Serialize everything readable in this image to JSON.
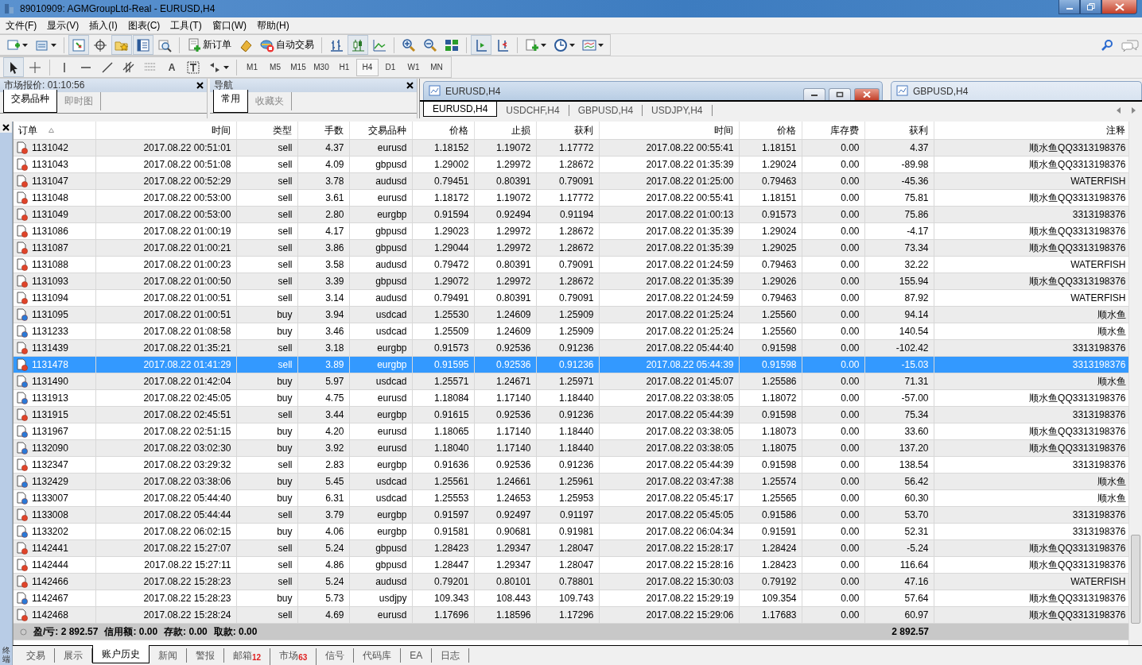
{
  "window": {
    "title": "89010909: AGMGroupLtd-Real - EURUSD,H4"
  },
  "menu": [
    "文件(F)",
    "显示(V)",
    "插入(I)",
    "图表(C)",
    "工具(T)",
    "窗口(W)",
    "帮助(H)"
  ],
  "toolbar": {
    "new_order": "新订单",
    "auto_trading": "自动交易"
  },
  "drawing_tools": {
    "text_tool": "A"
  },
  "timeframes": [
    {
      "label": "M1",
      "selected": false
    },
    {
      "label": "M5",
      "selected": false
    },
    {
      "label": "M15",
      "selected": false
    },
    {
      "label": "M30",
      "selected": false
    },
    {
      "label": "H1",
      "selected": false
    },
    {
      "label": "H4",
      "selected": true
    },
    {
      "label": "D1",
      "selected": false
    },
    {
      "label": "W1",
      "selected": false
    },
    {
      "label": "MN",
      "selected": false
    }
  ],
  "market_watch": {
    "title": "市场报价: 01:10:56",
    "tabs": [
      {
        "label": "交易品种",
        "selected": true
      },
      {
        "label": "即时图",
        "selected": false
      }
    ]
  },
  "navigator": {
    "title": "导航",
    "tabs": [
      {
        "label": "常用",
        "selected": true
      },
      {
        "label": "收藏夹",
        "selected": false
      }
    ]
  },
  "chart_windows": [
    {
      "title": "EURUSD,H4",
      "active": true
    },
    {
      "title": "GBPUSD,H4",
      "active": false
    }
  ],
  "chart_tabs": [
    {
      "label": "EURUSD,H4",
      "selected": true
    },
    {
      "label": "USDCHF,H4",
      "selected": false
    },
    {
      "label": "GBPUSD,H4",
      "selected": false
    },
    {
      "label": "USDJPY,H4",
      "selected": false
    }
  ],
  "terminal": {
    "label": "终端",
    "columns": [
      "订单",
      "时间",
      "类型",
      "手数",
      "交易品种",
      "价格",
      "止损",
      "获利",
      "时间",
      "价格",
      "库存费",
      "获利",
      "注释"
    ],
    "rows": [
      {
        "kind": "sell",
        "selected": false,
        "cells": [
          "1131042",
          "2017.08.22 00:51:01",
          "sell",
          "4.37",
          "eurusd",
          "1.18152",
          "1.19072",
          "1.17772",
          "2017.08.22 00:55:41",
          "1.18151",
          "0.00",
          "4.37",
          "顺水鱼QQ3313198376"
        ]
      },
      {
        "kind": "sell",
        "selected": false,
        "cells": [
          "1131043",
          "2017.08.22 00:51:08",
          "sell",
          "4.09",
          "gbpusd",
          "1.29002",
          "1.29972",
          "1.28672",
          "2017.08.22 01:35:39",
          "1.29024",
          "0.00",
          "-89.98",
          "顺水鱼QQ3313198376"
        ]
      },
      {
        "kind": "sell",
        "selected": false,
        "cells": [
          "1131047",
          "2017.08.22 00:52:29",
          "sell",
          "3.78",
          "audusd",
          "0.79451",
          "0.80391",
          "0.79091",
          "2017.08.22 01:25:00",
          "0.79463",
          "0.00",
          "-45.36",
          "WATERFISH"
        ]
      },
      {
        "kind": "sell",
        "selected": false,
        "cells": [
          "1131048",
          "2017.08.22 00:53:00",
          "sell",
          "3.61",
          "eurusd",
          "1.18172",
          "1.19072",
          "1.17772",
          "2017.08.22 00:55:41",
          "1.18151",
          "0.00",
          "75.81",
          "顺水鱼QQ3313198376"
        ]
      },
      {
        "kind": "sell",
        "selected": false,
        "cells": [
          "1131049",
          "2017.08.22 00:53:00",
          "sell",
          "2.80",
          "eurgbp",
          "0.91594",
          "0.92494",
          "0.91194",
          "2017.08.22 01:00:13",
          "0.91573",
          "0.00",
          "75.86",
          "3313198376"
        ]
      },
      {
        "kind": "sell",
        "selected": false,
        "cells": [
          "1131086",
          "2017.08.22 01:00:19",
          "sell",
          "4.17",
          "gbpusd",
          "1.29023",
          "1.29972",
          "1.28672",
          "2017.08.22 01:35:39",
          "1.29024",
          "0.00",
          "-4.17",
          "顺水鱼QQ3313198376"
        ]
      },
      {
        "kind": "sell",
        "selected": false,
        "cells": [
          "1131087",
          "2017.08.22 01:00:21",
          "sell",
          "3.86",
          "gbpusd",
          "1.29044",
          "1.29972",
          "1.28672",
          "2017.08.22 01:35:39",
          "1.29025",
          "0.00",
          "73.34",
          "顺水鱼QQ3313198376"
        ]
      },
      {
        "kind": "sell",
        "selected": false,
        "cells": [
          "1131088",
          "2017.08.22 01:00:23",
          "sell",
          "3.58",
          "audusd",
          "0.79472",
          "0.80391",
          "0.79091",
          "2017.08.22 01:24:59",
          "0.79463",
          "0.00",
          "32.22",
          "WATERFISH"
        ]
      },
      {
        "kind": "sell",
        "selected": false,
        "cells": [
          "1131093",
          "2017.08.22 01:00:50",
          "sell",
          "3.39",
          "gbpusd",
          "1.29072",
          "1.29972",
          "1.28672",
          "2017.08.22 01:35:39",
          "1.29026",
          "0.00",
          "155.94",
          "顺水鱼QQ3313198376"
        ]
      },
      {
        "kind": "sell",
        "selected": false,
        "cells": [
          "1131094",
          "2017.08.22 01:00:51",
          "sell",
          "3.14",
          "audusd",
          "0.79491",
          "0.80391",
          "0.79091",
          "2017.08.22 01:24:59",
          "0.79463",
          "0.00",
          "87.92",
          "WATERFISH"
        ]
      },
      {
        "kind": "buy",
        "selected": false,
        "cells": [
          "1131095",
          "2017.08.22 01:00:51",
          "buy",
          "3.94",
          "usdcad",
          "1.25530",
          "1.24609",
          "1.25909",
          "2017.08.22 01:25:24",
          "1.25560",
          "0.00",
          "94.14",
          "顺水鱼"
        ]
      },
      {
        "kind": "buy",
        "selected": false,
        "cells": [
          "1131233",
          "2017.08.22 01:08:58",
          "buy",
          "3.46",
          "usdcad",
          "1.25509",
          "1.24609",
          "1.25909",
          "2017.08.22 01:25:24",
          "1.25560",
          "0.00",
          "140.54",
          "顺水鱼"
        ]
      },
      {
        "kind": "sell",
        "selected": false,
        "cells": [
          "1131439",
          "2017.08.22 01:35:21",
          "sell",
          "3.18",
          "eurgbp",
          "0.91573",
          "0.92536",
          "0.91236",
          "2017.08.22 05:44:40",
          "0.91598",
          "0.00",
          "-102.42",
          "3313198376"
        ]
      },
      {
        "kind": "sell",
        "selected": true,
        "cells": [
          "1131478",
          "2017.08.22 01:41:29",
          "sell",
          "3.89",
          "eurgbp",
          "0.91595",
          "0.92536",
          "0.91236",
          "2017.08.22 05:44:39",
          "0.91598",
          "0.00",
          "-15.03",
          "3313198376"
        ]
      },
      {
        "kind": "buy",
        "selected": false,
        "cells": [
          "1131490",
          "2017.08.22 01:42:04",
          "buy",
          "5.97",
          "usdcad",
          "1.25571",
          "1.24671",
          "1.25971",
          "2017.08.22 01:45:07",
          "1.25586",
          "0.00",
          "71.31",
          "顺水鱼"
        ]
      },
      {
        "kind": "buy",
        "selected": false,
        "cells": [
          "1131913",
          "2017.08.22 02:45:05",
          "buy",
          "4.75",
          "eurusd",
          "1.18084",
          "1.17140",
          "1.18440",
          "2017.08.22 03:38:05",
          "1.18072",
          "0.00",
          "-57.00",
          "顺水鱼QQ3313198376"
        ]
      },
      {
        "kind": "sell",
        "selected": false,
        "cells": [
          "1131915",
          "2017.08.22 02:45:51",
          "sell",
          "3.44",
          "eurgbp",
          "0.91615",
          "0.92536",
          "0.91236",
          "2017.08.22 05:44:39",
          "0.91598",
          "0.00",
          "75.34",
          "3313198376"
        ]
      },
      {
        "kind": "buy",
        "selected": false,
        "cells": [
          "1131967",
          "2017.08.22 02:51:15",
          "buy",
          "4.20",
          "eurusd",
          "1.18065",
          "1.17140",
          "1.18440",
          "2017.08.22 03:38:05",
          "1.18073",
          "0.00",
          "33.60",
          "顺水鱼QQ3313198376"
        ]
      },
      {
        "kind": "buy",
        "selected": false,
        "cells": [
          "1132090",
          "2017.08.22 03:02:30",
          "buy",
          "3.92",
          "eurusd",
          "1.18040",
          "1.17140",
          "1.18440",
          "2017.08.22 03:38:05",
          "1.18075",
          "0.00",
          "137.20",
          "顺水鱼QQ3313198376"
        ]
      },
      {
        "kind": "sell",
        "selected": false,
        "cells": [
          "1132347",
          "2017.08.22 03:29:32",
          "sell",
          "2.83",
          "eurgbp",
          "0.91636",
          "0.92536",
          "0.91236",
          "2017.08.22 05:44:39",
          "0.91598",
          "0.00",
          "138.54",
          "3313198376"
        ]
      },
      {
        "kind": "buy",
        "selected": false,
        "cells": [
          "1132429",
          "2017.08.22 03:38:06",
          "buy",
          "5.45",
          "usdcad",
          "1.25561",
          "1.24661",
          "1.25961",
          "2017.08.22 03:47:38",
          "1.25574",
          "0.00",
          "56.42",
          "顺水鱼"
        ]
      },
      {
        "kind": "buy",
        "selected": false,
        "cells": [
          "1133007",
          "2017.08.22 05:44:40",
          "buy",
          "6.31",
          "usdcad",
          "1.25553",
          "1.24653",
          "1.25953",
          "2017.08.22 05:45:17",
          "1.25565",
          "0.00",
          "60.30",
          "顺水鱼"
        ]
      },
      {
        "kind": "sell",
        "selected": false,
        "cells": [
          "1133008",
          "2017.08.22 05:44:44",
          "sell",
          "3.79",
          "eurgbp",
          "0.91597",
          "0.92497",
          "0.91197",
          "2017.08.22 05:45:05",
          "0.91586",
          "0.00",
          "53.70",
          "3313198376"
        ]
      },
      {
        "kind": "buy",
        "selected": false,
        "cells": [
          "1133202",
          "2017.08.22 06:02:15",
          "buy",
          "4.06",
          "eurgbp",
          "0.91581",
          "0.90681",
          "0.91981",
          "2017.08.22 06:04:34",
          "0.91591",
          "0.00",
          "52.31",
          "3313198376"
        ]
      },
      {
        "kind": "sell",
        "selected": false,
        "cells": [
          "1142441",
          "2017.08.22 15:27:07",
          "sell",
          "5.24",
          "gbpusd",
          "1.28423",
          "1.29347",
          "1.28047",
          "2017.08.22 15:28:17",
          "1.28424",
          "0.00",
          "-5.24",
          "顺水鱼QQ3313198376"
        ]
      },
      {
        "kind": "sell",
        "selected": false,
        "cells": [
          "1142444",
          "2017.08.22 15:27:11",
          "sell",
          "4.86",
          "gbpusd",
          "1.28447",
          "1.29347",
          "1.28047",
          "2017.08.22 15:28:16",
          "1.28423",
          "0.00",
          "116.64",
          "顺水鱼QQ3313198376"
        ]
      },
      {
        "kind": "sell",
        "selected": false,
        "cells": [
          "1142466",
          "2017.08.22 15:28:23",
          "sell",
          "5.24",
          "audusd",
          "0.79201",
          "0.80101",
          "0.78801",
          "2017.08.22 15:30:03",
          "0.79192",
          "0.00",
          "47.16",
          "WATERFISH"
        ]
      },
      {
        "kind": "buy",
        "selected": false,
        "cells": [
          "1142467",
          "2017.08.22 15:28:23",
          "buy",
          "5.73",
          "usdjpy",
          "109.343",
          "108.443",
          "109.743",
          "2017.08.22 15:29:19",
          "109.354",
          "0.00",
          "57.64",
          "顺水鱼QQ3313198376"
        ]
      },
      {
        "kind": "sell",
        "selected": false,
        "cells": [
          "1142468",
          "2017.08.22 15:28:24",
          "sell",
          "4.69",
          "eurusd",
          "1.17696",
          "1.18596",
          "1.17296",
          "2017.08.22 15:29:06",
          "1.17683",
          "0.00",
          "60.97",
          "顺水鱼QQ3313198376"
        ]
      }
    ],
    "summary": [
      "盈/亏: 2 892.57",
      "信用额: 0.00",
      "存款: 0.00",
      "取款: 0.00"
    ],
    "total": "2 892.57",
    "tabs": [
      {
        "label": "交易",
        "selected": false
      },
      {
        "label": "展示",
        "selected": false
      },
      {
        "label": "账户历史",
        "selected": true
      },
      {
        "label": "新闻",
        "selected": false
      },
      {
        "label": "警报",
        "selected": false
      },
      {
        "label": "邮箱",
        "selected": false,
        "count": "12"
      },
      {
        "label": "市场",
        "selected": false,
        "count": "63"
      },
      {
        "label": "信号",
        "selected": false
      },
      {
        "label": "代码库",
        "selected": false
      },
      {
        "label": "EA",
        "selected": false
      },
      {
        "label": "日志",
        "selected": false
      }
    ]
  }
}
